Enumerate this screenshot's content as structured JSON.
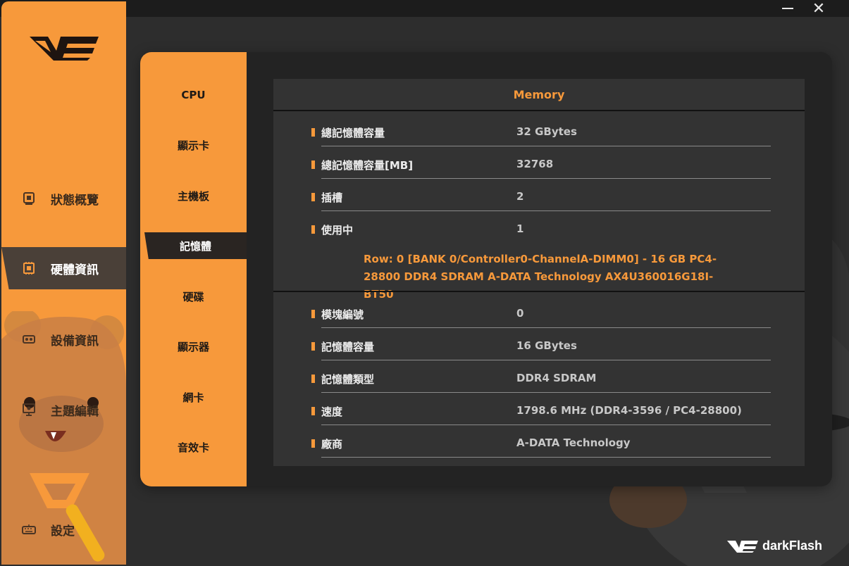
{
  "window": {
    "minimize_label": "—",
    "close_label": "✕"
  },
  "sidebar": {
    "items": [
      {
        "label": "狀態概覽",
        "icon": "monitor-icon"
      },
      {
        "label": "硬體資訊",
        "icon": "chip-icon",
        "active": true
      },
      {
        "label": "設備資訊",
        "icon": "device-icon"
      },
      {
        "label": "主題編輯",
        "icon": "theme-icon"
      },
      {
        "label": "設定",
        "icon": "keyboard-icon"
      }
    ]
  },
  "subnav": {
    "items": [
      "CPU",
      "顯示卡",
      "主機板",
      "記憶體",
      "硬碟",
      "顯示器",
      "網卡",
      "音效卡"
    ],
    "active_index": 3
  },
  "memory": {
    "title": "Memory",
    "summary": [
      {
        "key": "總記憶體容量",
        "value": "32 GBytes"
      },
      {
        "key": "總記憶體容量[MB]",
        "value": "32768"
      },
      {
        "key": "插槽",
        "value": "2"
      },
      {
        "key": "使用中",
        "value": "1"
      }
    ],
    "slot_info": "Row: 0 [BANK 0/Controller0-ChannelA-DIMM0] - 16 GB PC4-28800 DDR4 SDRAM A-DATA Technology AX4U360016G18I-BT50",
    "module": [
      {
        "key": "模塊編號",
        "value": "0"
      },
      {
        "key": "記憶體容量",
        "value": "16 GBytes"
      },
      {
        "key": "記憶體類型",
        "value": "DDR4 SDRAM"
      },
      {
        "key": "速度",
        "value": "1798.6 MHz (DDR4-3596 / PC4-28800)"
      },
      {
        "key": "廠商",
        "value": "A-DATA Technology"
      }
    ]
  },
  "brand": {
    "name": "darkFlash"
  },
  "colors": {
    "accent": "#f7993b",
    "panel": "#232323",
    "content": "#333333",
    "sidebar_active": "#4a4038"
  }
}
